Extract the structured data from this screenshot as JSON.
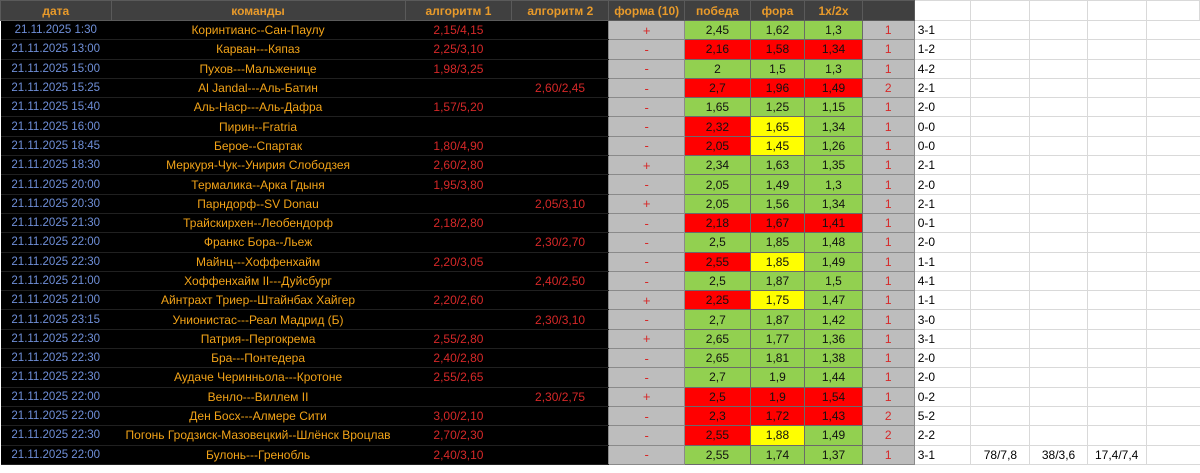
{
  "headers": [
    "дата",
    "команды",
    "алгоритм 1",
    "алгоритм 2",
    "форма (10)",
    "победа",
    "фора",
    "1х/2х",
    ""
  ],
  "colors": {
    "green": "#92d050",
    "red": "#ff0000",
    "yellow": "#ffff00",
    "header_bg": "#404040",
    "header_text": "#e89a2a"
  },
  "rows": [
    {
      "date": "21.11.2025 1:30",
      "teams": "Коринтианс--Сан-Паулу",
      "alg1": "2,15/4,15",
      "alg2": "",
      "form": "+",
      "win": "2,45",
      "fora": "1,62",
      "dc": "1,3",
      "colors": [
        "g",
        "g",
        "g"
      ],
      "bet": "1",
      "score": "3-1",
      "extra": [
        "",
        "",
        "",
        ""
      ]
    },
    {
      "date": "21.11.2025 13:00",
      "teams": "Карван---Кяпаз",
      "alg1": "2,25/3,10",
      "alg2": "",
      "form": "-",
      "win": "2,16",
      "fora": "1,58",
      "dc": "1,34",
      "colors": [
        "r",
        "r",
        "r"
      ],
      "bet": "1",
      "score": "1-2",
      "extra": [
        "",
        "",
        "",
        ""
      ]
    },
    {
      "date": "21.11.2025 15:00",
      "teams": "Пухов---Мальженице",
      "alg1": "1,98/3,25",
      "alg2": "",
      "form": "-",
      "win": "2",
      "fora": "1,5",
      "dc": "1,3",
      "colors": [
        "g",
        "g",
        "g"
      ],
      "bet": "1",
      "score": "4-2",
      "extra": [
        "",
        "",
        "",
        ""
      ]
    },
    {
      "date": "21.11.2025 15:25",
      "teams": "Al Jandal---Аль-Батин",
      "alg1": "",
      "alg2": "2,60/2,45",
      "form": "-",
      "win": "2,7",
      "fora": "1,96",
      "dc": "1,49",
      "colors": [
        "r",
        "r",
        "r"
      ],
      "bet": "2",
      "score": "2-1",
      "extra": [
        "",
        "",
        "",
        ""
      ]
    },
    {
      "date": "21.11.2025 15:40",
      "teams": "Аль-Наср---Аль-Дафра",
      "alg1": "1,57/5,20",
      "alg2": "",
      "form": "-",
      "win": "1,65",
      "fora": "1,25",
      "dc": "1,15",
      "colors": [
        "g",
        "g",
        "g"
      ],
      "bet": "1",
      "score": "2-0",
      "extra": [
        "",
        "",
        "",
        ""
      ]
    },
    {
      "date": "21.11.2025 16:00",
      "teams": "Пирин--Fratria",
      "alg1": "",
      "alg2": "",
      "form": "-",
      "win": "2,32",
      "fora": "1,65",
      "dc": "1,34",
      "colors": [
        "r",
        "y",
        "g"
      ],
      "bet": "1",
      "score": "0-0",
      "extra": [
        "",
        "",
        "",
        ""
      ]
    },
    {
      "date": "21.11.2025 18:45",
      "teams": "Берое--Спартак",
      "alg1": "1,80/4,90",
      "alg2": "",
      "form": "-",
      "win": "2,05",
      "fora": "1,45",
      "dc": "1,26",
      "colors": [
        "r",
        "y",
        "g"
      ],
      "bet": "1",
      "score": "0-0",
      "extra": [
        "",
        "",
        "",
        ""
      ]
    },
    {
      "date": "21.11.2025 18:30",
      "teams": "Меркуря-Чук--Унирия Слободзея",
      "alg1": "2,60/2,80",
      "alg2": "",
      "form": "+",
      "win": "2,34",
      "fora": "1,63",
      "dc": "1,35",
      "colors": [
        "g",
        "g",
        "g"
      ],
      "bet": "1",
      "score": "2-1",
      "extra": [
        "",
        "",
        "",
        ""
      ]
    },
    {
      "date": "21.11.2025 20:00",
      "teams": "Термалика--Арка Гдыня",
      "alg1": "1,95/3,80",
      "alg2": "",
      "form": "-",
      "win": "2,05",
      "fora": "1,49",
      "dc": "1,3",
      "colors": [
        "g",
        "g",
        "g"
      ],
      "bet": "1",
      "score": "2-0",
      "extra": [
        "",
        "",
        "",
        ""
      ]
    },
    {
      "date": "21.11.2025 20:30",
      "teams": "Парндорф--SV Donau",
      "alg1": "",
      "alg2": "2,05/3,10",
      "form": "+",
      "win": "2,05",
      "fora": "1,56",
      "dc": "1,34",
      "colors": [
        "g",
        "g",
        "g"
      ],
      "bet": "1",
      "score": "2-1",
      "extra": [
        "",
        "",
        "",
        ""
      ]
    },
    {
      "date": "21.11.2025 21:30",
      "teams": "Трайскирхен--Леобендорф",
      "alg1": "2,18/2,80",
      "alg2": "",
      "form": "-",
      "win": "2,18",
      "fora": "1,67",
      "dc": "1,41",
      "colors": [
        "r",
        "r",
        "r"
      ],
      "bet": "1",
      "score": "0-1",
      "extra": [
        "",
        "",
        "",
        ""
      ]
    },
    {
      "date": "21.11.2025 22:00",
      "teams": "Франкс Бора--Льеж",
      "alg1": "",
      "alg2": "2,30/2,70",
      "form": "-",
      "win": "2,5",
      "fora": "1,85",
      "dc": "1,48",
      "colors": [
        "g",
        "g",
        "g"
      ],
      "bet": "1",
      "score": "2-0",
      "extra": [
        "",
        "",
        "",
        ""
      ]
    },
    {
      "date": "21.11.2025 22:30",
      "teams": "Майнц---Хоффенхайм",
      "alg1": "2,20/3,05",
      "alg2": "",
      "form": "-",
      "win": "2,55",
      "fora": "1,85",
      "dc": "1,49",
      "colors": [
        "r",
        "y",
        "g"
      ],
      "bet": "1",
      "score": "1-1",
      "extra": [
        "",
        "",
        "",
        ""
      ]
    },
    {
      "date": "21.11.2025 21:00",
      "teams": "Хоффенхайм II---Дуйсбург",
      "alg1": "",
      "alg2": "2,40/2,50",
      "form": "-",
      "win": "2,5",
      "fora": "1,87",
      "dc": "1,5",
      "colors": [
        "g",
        "g",
        "g"
      ],
      "bet": "1",
      "score": "4-1",
      "extra": [
        "",
        "",
        "",
        ""
      ]
    },
    {
      "date": "21.11.2025 21:00",
      "teams": "Айнтрахт Триер--Штайнбах Хайгер",
      "alg1": "2,20/2,60",
      "alg2": "",
      "form": "+",
      "win": "2,25",
      "fora": "1,75",
      "dc": "1,47",
      "colors": [
        "r",
        "y",
        "g"
      ],
      "bet": "1",
      "score": "1-1",
      "extra": [
        "",
        "",
        "",
        ""
      ]
    },
    {
      "date": "21.11.2025 23:15",
      "teams": "Унионистас---Реал Мадрид (Б)",
      "alg1": "",
      "alg2": "2,30/3,10",
      "form": "-",
      "win": "2,7",
      "fora": "1,87",
      "dc": "1,42",
      "colors": [
        "g",
        "g",
        "g"
      ],
      "bet": "1",
      "score": "3-0",
      "extra": [
        "",
        "",
        "",
        ""
      ]
    },
    {
      "date": "21.11.2025 22:30",
      "teams": "Патрия--Пергокрема",
      "alg1": "2,55/2,80",
      "alg2": "",
      "form": "+",
      "win": "2,65",
      "fora": "1,77",
      "dc": "1,36",
      "colors": [
        "g",
        "g",
        "g"
      ],
      "bet": "1",
      "score": "3-1",
      "extra": [
        "",
        "",
        "",
        ""
      ]
    },
    {
      "date": "21.11.2025 22:30",
      "teams": "Бра---Понтедера",
      "alg1": "2,40/2,80",
      "alg2": "",
      "form": "-",
      "win": "2,65",
      "fora": "1,81",
      "dc": "1,38",
      "colors": [
        "g",
        "g",
        "g"
      ],
      "bet": "1",
      "score": "2-0",
      "extra": [
        "",
        "",
        "",
        ""
      ]
    },
    {
      "date": "21.11.2025 22:30",
      "teams": "Аудаче Черинньола---Кротоне",
      "alg1": "2,55/2,65",
      "alg2": "",
      "form": "-",
      "win": "2,7",
      "fora": "1,9",
      "dc": "1,44",
      "colors": [
        "g",
        "g",
        "g"
      ],
      "bet": "1",
      "score": "2-0",
      "extra": [
        "",
        "",
        "",
        ""
      ]
    },
    {
      "date": "21.11.2025 22:00",
      "teams": "Венло---Виллем II",
      "alg1": "",
      "alg2": "2,30/2,75",
      "form": "+",
      "win": "2,5",
      "fora": "1,9",
      "dc": "1,54",
      "colors": [
        "r",
        "r",
        "r"
      ],
      "bet": "1",
      "score": "0-2",
      "extra": [
        "",
        "",
        "",
        ""
      ]
    },
    {
      "date": "21.11.2025 22:00",
      "teams": "Ден Босх---Алмере Сити",
      "alg1": "3,00/2,10",
      "alg2": "",
      "form": "-",
      "win": "2,3",
      "fora": "1,72",
      "dc": "1,43",
      "colors": [
        "r",
        "r",
        "r"
      ],
      "bet": "2",
      "score": "5-2",
      "extra": [
        "",
        "",
        "",
        ""
      ]
    },
    {
      "date": "21.11.2025 22:30",
      "teams": "Погонь Гродзиск-Мазовецкий--Шлёнск Вроцлав",
      "alg1": "2,70/2,30",
      "alg2": "",
      "form": "-",
      "win": "2,55",
      "fora": "1,88",
      "dc": "1,49",
      "colors": [
        "r",
        "y",
        "g"
      ],
      "bet": "2",
      "score": "2-2",
      "extra": [
        "",
        "",
        "",
        ""
      ]
    },
    {
      "date": "21.11.2025 22:00",
      "teams": "Булонь---Гренобль",
      "alg1": "2,40/3,10",
      "alg2": "",
      "form": "-",
      "win": "2,55",
      "fora": "1,74",
      "dc": "1,37",
      "colors": [
        "g",
        "g",
        "g"
      ],
      "bet": "1",
      "score": "3-1",
      "extra": [
        "78/7,8",
        "38/3,6",
        "17,4/7,4",
        ""
      ]
    }
  ]
}
